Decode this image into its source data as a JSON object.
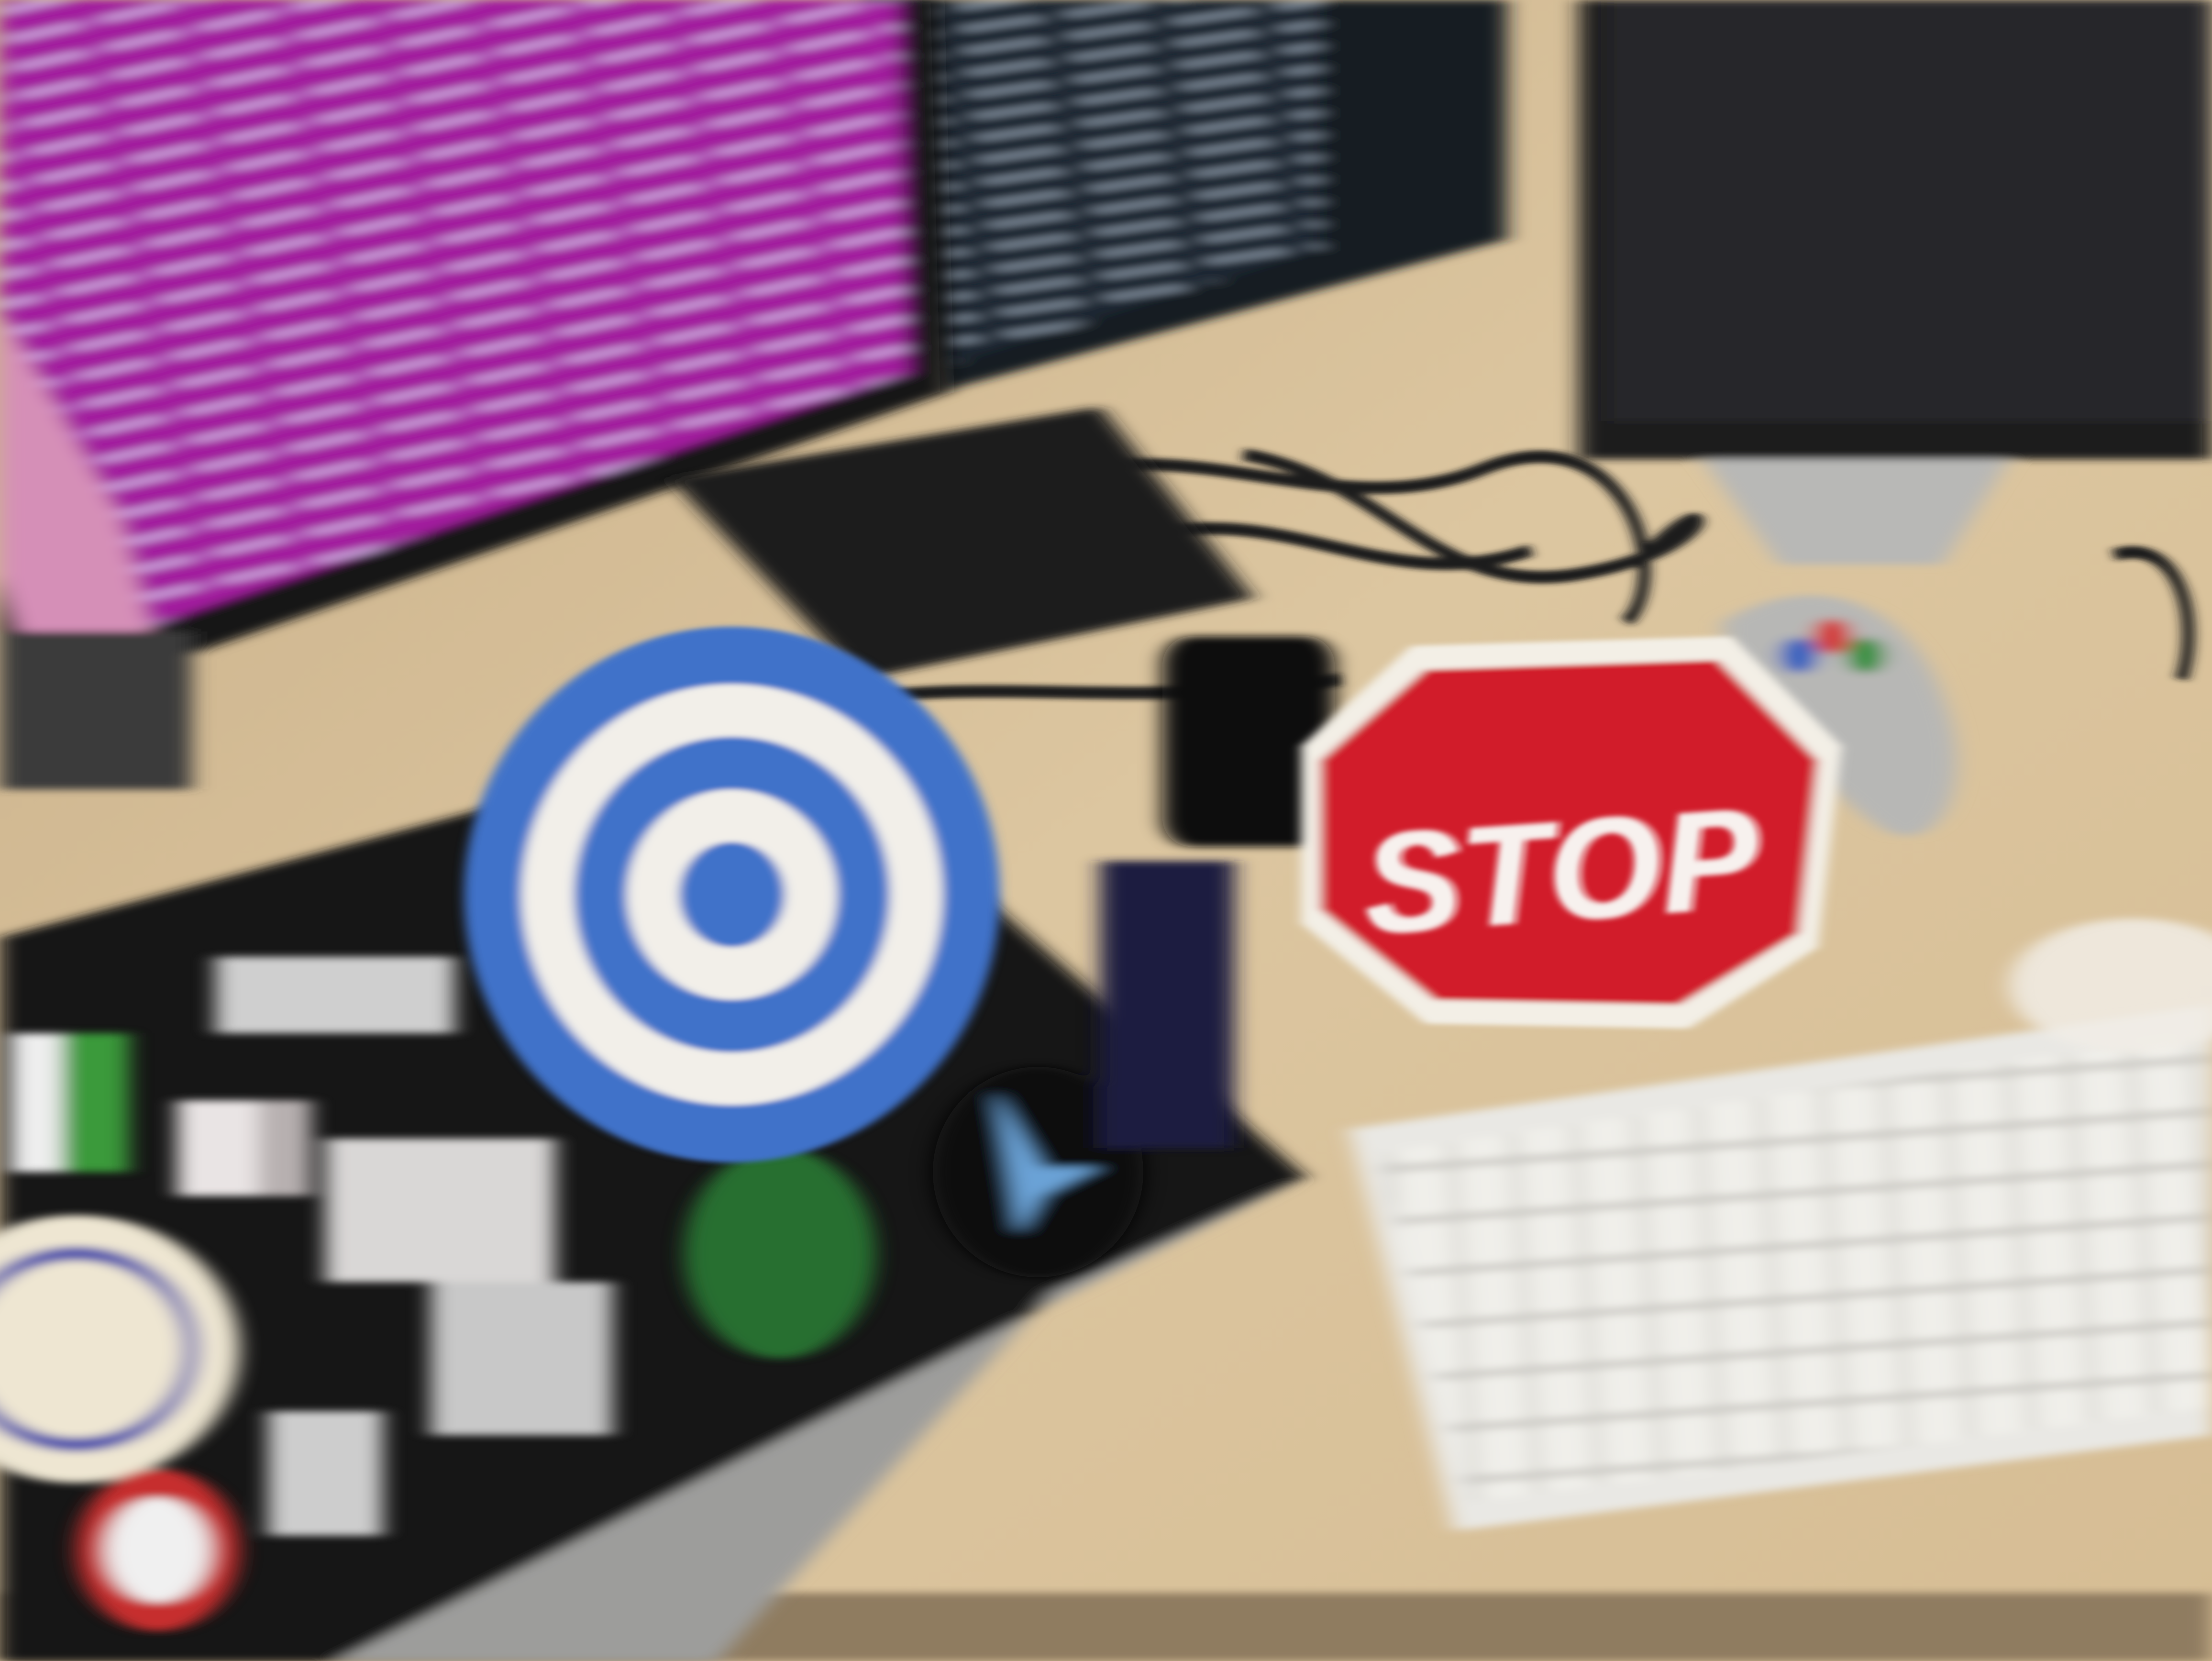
{
  "scene": {
    "description_free": true,
    "objects": {
      "stop_sign": {
        "text": "STOP",
        "color": "#d11f2b"
      },
      "target_sticker": {
        "colors": [
          "#3f72c9",
          "#f2efe9"
        ]
      },
      "monitor_left": {
        "screen_color": "#a21b9e"
      },
      "monitor_right": {
        "screen_color": "#1f2933"
      },
      "keyboard": {
        "color": "#e9e8e4"
      },
      "desk": {
        "color": "#d8c29c"
      }
    }
  }
}
